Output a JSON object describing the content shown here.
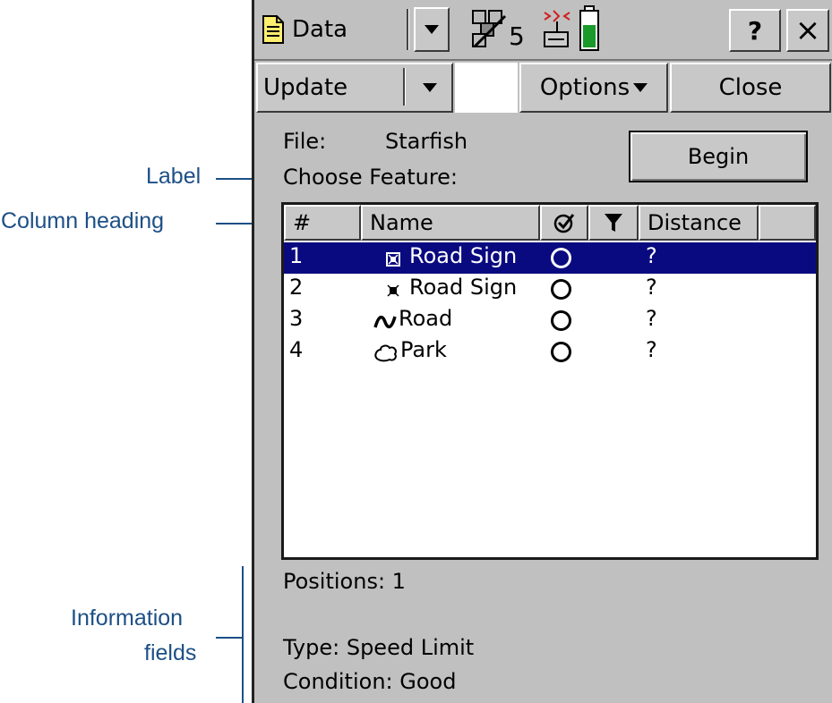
{
  "annotations": {
    "label": "Label",
    "column_heading": "Column heading",
    "information_fields_line1": "Information",
    "information_fields_line2": "fields"
  },
  "toolbar": {
    "data_label": "Data",
    "satellite_count": "5",
    "help_label": "?",
    "close_x": "×",
    "update_label": "Update",
    "options_label": "Options",
    "close_label": "Close"
  },
  "form": {
    "file_label": "File:",
    "file_value": "Starfish",
    "choose_feature_label": "Choose Feature:",
    "begin_label": "Begin"
  },
  "list": {
    "headers": {
      "num": "#",
      "name": "Name",
      "distance": "Distance"
    },
    "rows": [
      {
        "num": "1",
        "name": "Road Sign",
        "icon": "point-feature-icon",
        "distance": "?",
        "selected": true
      },
      {
        "num": "2",
        "name": "Road Sign",
        "icon": "small-point-feature-icon",
        "distance": "?",
        "selected": false
      },
      {
        "num": "3",
        "name": "Road",
        "icon": "line-feature-icon",
        "distance": "?",
        "selected": false
      },
      {
        "num": "4",
        "name": "Park",
        "icon": "area-feature-icon",
        "distance": "?",
        "selected": false
      }
    ]
  },
  "info": {
    "positions": "Positions:  1",
    "type": "Type: Speed Limit",
    "condition": "Condition: Good"
  },
  "colors": {
    "selection": "#0a0a80",
    "screen_bg": "#c0c0c0",
    "callout": "#1d4f86",
    "battery": "#1a9a2a"
  }
}
